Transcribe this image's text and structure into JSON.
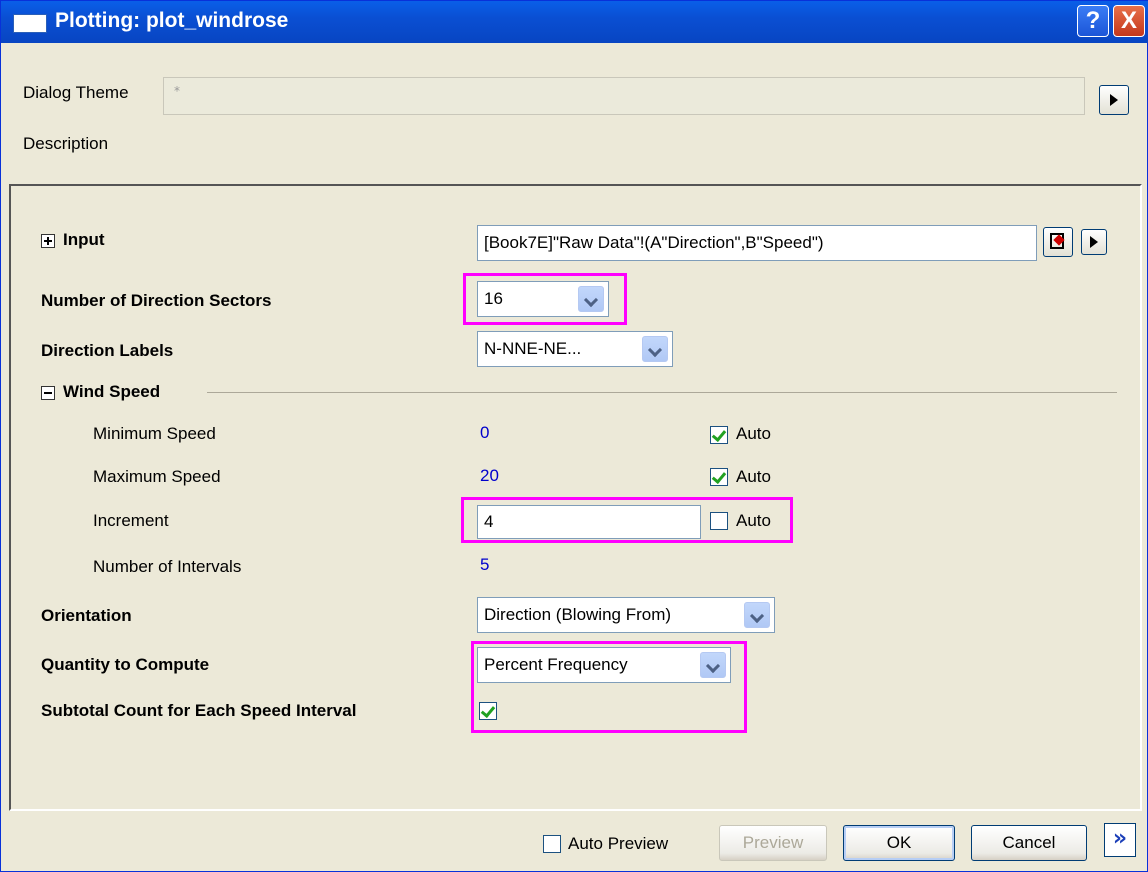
{
  "window": {
    "title": "Plotting: plot_windrose",
    "help_glyph": "?",
    "close_glyph": "X"
  },
  "theme": {
    "label": "Dialog Theme",
    "value": "*"
  },
  "description_label": "Description",
  "input": {
    "label": "Input",
    "value": "[Book7E]\"Raw Data\"!(A\"Direction\",B\"Speed\")"
  },
  "sectors": {
    "label": "Number of Direction Sectors",
    "value": "16"
  },
  "direction_labels": {
    "label": "Direction Labels",
    "value": "N-NNE-NE..."
  },
  "wind_speed": {
    "label": "Wind Speed",
    "min": {
      "label": "Minimum Speed",
      "value": "0",
      "auto_label": "Auto",
      "auto": true
    },
    "max": {
      "label": "Maximum Speed",
      "value": "20",
      "auto_label": "Auto",
      "auto": true
    },
    "increment": {
      "label": "Increment",
      "value": "4",
      "auto_label": "Auto",
      "auto": false
    },
    "intervals": {
      "label": "Number of Intervals",
      "value": "5"
    }
  },
  "orientation": {
    "label": "Orientation",
    "value": "Direction (Blowing From)"
  },
  "quantity": {
    "label": "Quantity to Compute",
    "value": "Percent Frequency"
  },
  "subtotal": {
    "label": "Subtotal Count for Each Speed Interval",
    "checked": true
  },
  "footer": {
    "auto_preview_label": "Auto Preview",
    "preview_label": "Preview",
    "ok_label": "OK",
    "cancel_label": "Cancel",
    "more_glyph": "»"
  },
  "colors": {
    "highlight": "#ff00ff",
    "title_bar": "#0a4fd3",
    "value_blue": "#0000cc"
  }
}
